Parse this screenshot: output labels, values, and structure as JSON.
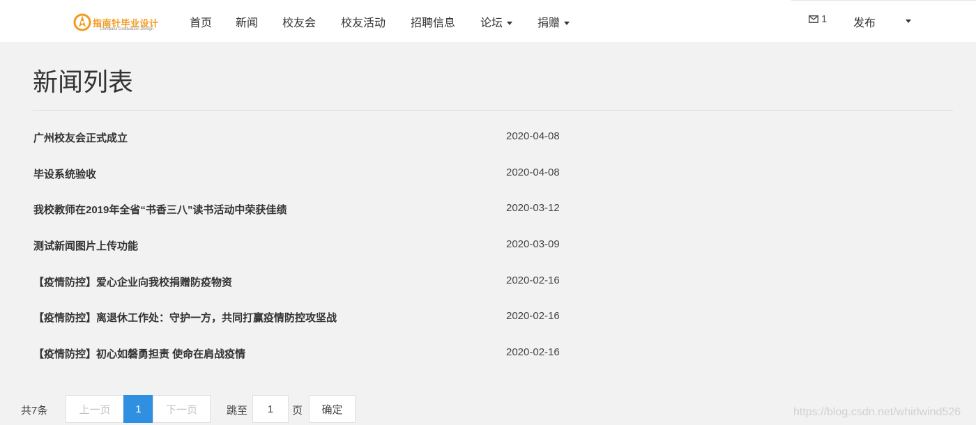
{
  "brand": {
    "title": "指南针毕业设计",
    "subtitle": "Compass Graduation Design",
    "accent_color": "#f29a1f"
  },
  "nav": {
    "items": [
      {
        "label": "首页",
        "has_dropdown": false
      },
      {
        "label": "新闻",
        "has_dropdown": false
      },
      {
        "label": "校友会",
        "has_dropdown": false
      },
      {
        "label": "校友活动",
        "has_dropdown": false
      },
      {
        "label": "招聘信息",
        "has_dropdown": false
      },
      {
        "label": "论坛",
        "has_dropdown": true
      },
      {
        "label": "捐赠",
        "has_dropdown": true
      }
    ],
    "mail_icon": "envelope-icon",
    "mail_count": "1",
    "publish_label": "发布",
    "user_menu_icon": "caret-down-icon"
  },
  "main": {
    "page_title": "新闻列表",
    "news": [
      {
        "title": "广州校友会正式成立",
        "date": "2020-04-08"
      },
      {
        "title": "毕设系统验收",
        "date": "2020-04-08"
      },
      {
        "title": "我校教师在2019年全省“书香三八”读书活动中荣获佳绩",
        "date": "2020-03-12"
      },
      {
        "title": "测试新闻图片上传功能",
        "date": "2020-03-09"
      },
      {
        "title": "【疫情防控】爱心企业向我校捐赠防疫物资",
        "date": "2020-02-16"
      },
      {
        "title": "【疫情防控】离退休工作处：守护一方，共同打赢疫情防控攻坚战",
        "date": "2020-02-16"
      },
      {
        "title": "【疫情防控】初心如磐勇担责 使命在肩战疫情",
        "date": "2020-02-16"
      }
    ]
  },
  "pagination": {
    "total": "共7条",
    "prev": "上一页",
    "current": "1",
    "next": "下一页",
    "jump_label": "跳至",
    "jump_value": "1",
    "page_unit": "页",
    "confirm": "确定",
    "active_color": "#2f8fe0"
  },
  "watermark": "https://blog.csdn.net/whirlwind526"
}
